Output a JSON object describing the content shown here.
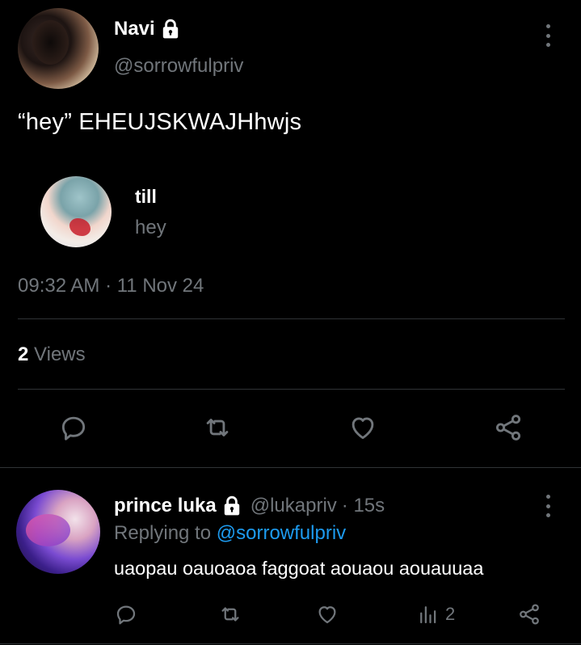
{
  "tweet": {
    "author_name": "Navi",
    "author_handle": "@sorrowfulpriv",
    "text": "“hey” EHEUJSKWAJHhwjs",
    "quoted": {
      "name": "till",
      "text": "hey"
    },
    "timestamp": "09:32 AM · 11 Nov 24",
    "views_count": "2",
    "views_label": "Views"
  },
  "reply": {
    "author_name": "prince luka",
    "author_handle": "@lukapriv",
    "time_ago": "· 15s",
    "replying_label": "Replying to",
    "replying_to": "@sorrowfulpriv",
    "text": "uaopau oauoaoa faggoat aouaou aouauuaa",
    "views_count": "2"
  },
  "colors": {
    "background": "#000000",
    "text_primary": "#ffffff",
    "text_secondary": "#71767b",
    "divider": "#2f3336",
    "accent": "#1d9bf0"
  },
  "icons": [
    "lock-icon",
    "more-icon",
    "reply-icon",
    "retweet-icon",
    "like-icon",
    "share-icon",
    "views-icon"
  ]
}
